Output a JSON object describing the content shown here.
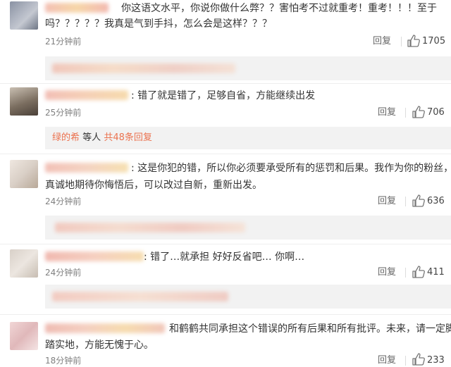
{
  "comments": [
    {
      "text_lines": [
        "你这语文水平，你说你做什么弊？？害怕考不过就重考！重考！！！至于",
        "吗？？？？？我真是气到手抖，怎么会是这样？？？"
      ],
      "time": "21分钟前",
      "reply": "回复",
      "likes": "1705"
    },
    {
      "text_lines": [
        ": 错了就是错了，足够自省，方能继续出发"
      ],
      "time": "25分钟前",
      "reply": "回复",
      "likes": "706",
      "sub_replies": {
        "user": "绿的希",
        "middle": "等人",
        "count": "共48条回复"
      }
    },
    {
      "text_lines": [
        ": 这是你犯的错，所以你必须要承受所有的惩罚和后果。我作为你的粉丝，",
        "真诚地期待你悔悟后，可以改过自新，重新出发。"
      ],
      "time": "24分钟前",
      "reply": "回复",
      "likes": "636"
    },
    {
      "text_lines": [
        ": 错了…就承担 好好反省吧… 你啊…"
      ],
      "time": "24分钟前",
      "reply": "回复",
      "likes": "411"
    },
    {
      "text_lines": [
        "和鹤鹤共同承担这个错误的所有后果和所有批评。未来，请一定脚",
        "踏实地，方能无愧于心。"
      ],
      "time": "18分钟前",
      "reply": "回复",
      "likes": "233"
    }
  ],
  "colors": {
    "accent": "#eb7350",
    "secondary_text": "#808080",
    "subreply_bg": "#f2f2f2"
  }
}
